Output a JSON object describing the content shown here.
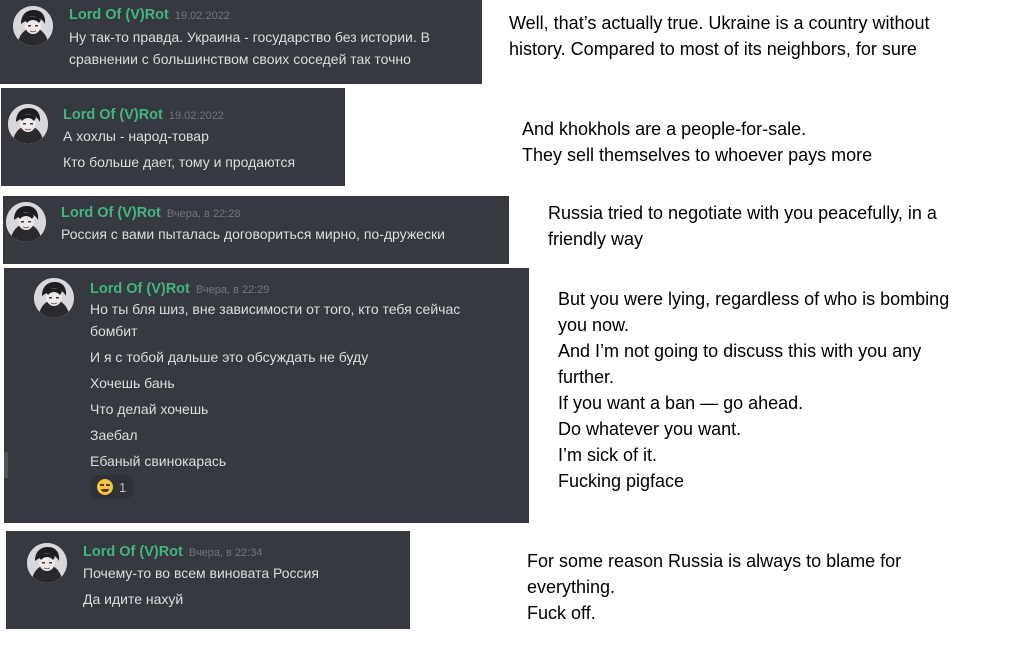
{
  "messages": [
    {
      "author": "Lord Of (V)Rot",
      "time": "19.02.2022",
      "lines": [
        "Ну так-то правда. Украина - государство без истории. В",
        "сравнении с большинством своих соседей так точно"
      ],
      "translation": [
        "Well, that’s actually true. Ukraine is a country without",
        "history. Compared to most of its neighbors, for sure"
      ]
    },
    {
      "author": "Lord Of (V)Rot",
      "time": "19.02.2022",
      "lines": [
        "А хохлы - народ-товар",
        "Кто больше дает, тому и продаются"
      ],
      "translation": [
        "And khokhols are a people-for-sale.",
        "They sell themselves to whoever pays more"
      ]
    },
    {
      "author": "Lord Of (V)Rot",
      "time": "Вчера, в 22:28",
      "lines": [
        "Россия с вами пыталась договориться мирно, по-дружески"
      ],
      "translation": [
        "Russia tried to negotiate with you peacefully, in a",
        "friendly way"
      ]
    },
    {
      "author": "Lord Of (V)Rot",
      "time": "Вчера, в 22:29",
      "lines": [
        "Но ты бля шиз, вне зависимости от того, кто тебя сейчас",
        "бомбит",
        "И я с тобой дальше это обсуждать не буду",
        "Хочешь бань",
        "Что делай хочешь",
        "Заебал",
        "Ебаный свинокарась"
      ],
      "reaction": {
        "emoji": "grimacing-face",
        "count": "1"
      },
      "translation": [
        "But you were lying, regardless of who is bombing",
        "you now.",
        "And I’m not going to discuss this with you any",
        "further.",
        "If you want a ban — go ahead.",
        "Do whatever you want.",
        "I’m sick of it.",
        "Fucking pigface"
      ]
    },
    {
      "author": "Lord Of (V)Rot",
      "time": "Вчера, в 22:34",
      "lines": [
        "Почему-то во всем виновата Россия",
        "Да идите нахуй"
      ],
      "translation": [
        "For some reason Russia is always to blame for",
        "everything.",
        "Fuck off."
      ]
    }
  ],
  "colors": {
    "card_bg": "#36393f",
    "author": "#43b581",
    "text": "#dcddde",
    "timestamp": "#72767d"
  }
}
